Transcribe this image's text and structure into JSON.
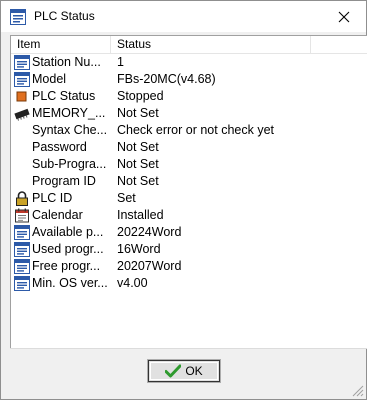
{
  "window": {
    "title": "PLC Status",
    "close_glyph": "✕"
  },
  "list": {
    "columns": [
      "Item",
      "Status"
    ],
    "rows": [
      {
        "icon": "window-icon",
        "name": "Station Nu...",
        "value": "1"
      },
      {
        "icon": "window-icon",
        "name": "Model",
        "value": "FBs-20MC(v4.68)"
      },
      {
        "icon": "status-square-icon",
        "name": "PLC Status",
        "value": "Stopped"
      },
      {
        "icon": "memory-chip-icon",
        "name": "MEMORY_...",
        "value": "Not Set"
      },
      {
        "icon": "",
        "name": "Syntax Che...",
        "value": "Check error or not check yet"
      },
      {
        "icon": "",
        "name": "Password",
        "value": "Not Set"
      },
      {
        "icon": "",
        "name": "Sub-Progra...",
        "value": "Not Set"
      },
      {
        "icon": "",
        "name": "Program ID",
        "value": "Not Set"
      },
      {
        "icon": "lock-icon",
        "name": "PLC ID",
        "value": "Set"
      },
      {
        "icon": "calendar-icon",
        "name": "Calendar",
        "value": "Installed"
      },
      {
        "icon": "window-icon",
        "name": "Available p...",
        "value": "20224Word"
      },
      {
        "icon": "window-icon",
        "name": "Used progr...",
        "value": "16Word"
      },
      {
        "icon": "window-icon",
        "name": "Free progr...",
        "value": "20207Word"
      },
      {
        "icon": "window-icon",
        "name": "Min. OS ver...",
        "value": "v4.00"
      }
    ]
  },
  "ok_button": {
    "label": "OK"
  },
  "colors": {
    "window_bg": "#f0f0f0",
    "list_bg": "#ffffff",
    "icon_blue": "#2d5aa8",
    "status_square": "#e07020",
    "check_green": "#2e9a2e"
  }
}
